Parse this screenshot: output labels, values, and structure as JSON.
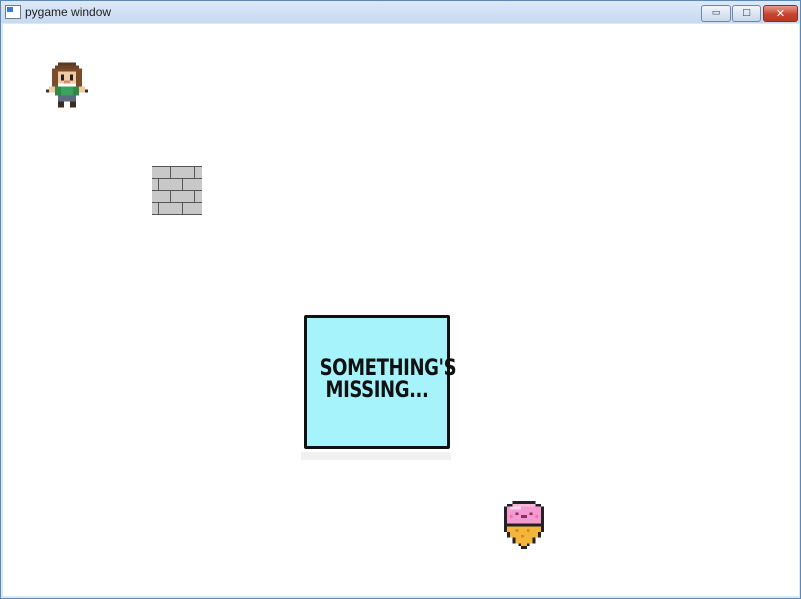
{
  "window": {
    "title": "pygame window",
    "controls": {
      "minimize": "▭",
      "maximize": "□",
      "close": "✕"
    }
  },
  "game": {
    "missing_texture": {
      "line1": "SOMETHING'S",
      "line2": "MISSING..."
    },
    "sprites": [
      "player-character",
      "brick-wall",
      "ice-cream"
    ],
    "colors": {
      "missing_bg": "#a6f3fb",
      "background": "#ffffff",
      "ice_cream_scoop": "#f49ad1",
      "cone": "#f4b63a",
      "brick": "#c8c8c8"
    }
  }
}
